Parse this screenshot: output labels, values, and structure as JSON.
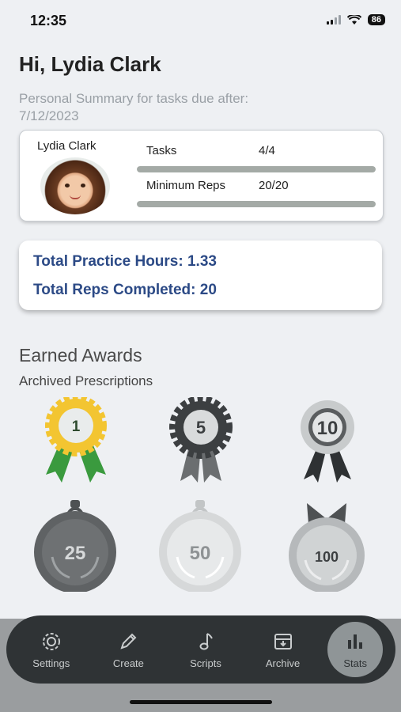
{
  "status_bar": {
    "time": "12:35",
    "battery": "86"
  },
  "greeting": "Hi, Lydia Clark",
  "subtitle_line1": "Personal Summary for tasks due after:",
  "subtitle_line2": "7/12/2023",
  "summary": {
    "name": "Lydia Clark",
    "tasks_label": "Tasks",
    "tasks_value": "4/4",
    "tasks_progress": 1.0,
    "reps_label": "Minimum Reps",
    "reps_value": "20/20",
    "reps_progress": 1.0
  },
  "totals": {
    "practice_hours": "Total Practice Hours: 1.33",
    "reps_completed": "Total Reps Completed: 20"
  },
  "awards_title": "Earned Awards",
  "awards_subtitle": "Archived Prescriptions",
  "awards": [
    {
      "label": "1",
      "earned": true
    },
    {
      "label": "5",
      "earned": false
    },
    {
      "label": "10",
      "earned": false
    },
    {
      "label": "25",
      "earned": false
    },
    {
      "label": "50",
      "earned": false
    },
    {
      "label": "100",
      "earned": false
    }
  ],
  "colors": {
    "accent_blue": "#2c4a86",
    "gold": "#f3c531",
    "green": "#3a9a3e",
    "tab_bar": "#2f3335"
  },
  "tabs": [
    {
      "label": "Settings",
      "icon": "gear-icon"
    },
    {
      "label": "Create",
      "icon": "pencil-icon"
    },
    {
      "label": "Scripts",
      "icon": "music-note-icon"
    },
    {
      "label": "Archive",
      "icon": "archive-icon"
    },
    {
      "label": "Stats",
      "icon": "bar-chart-icon",
      "active": true
    }
  ]
}
